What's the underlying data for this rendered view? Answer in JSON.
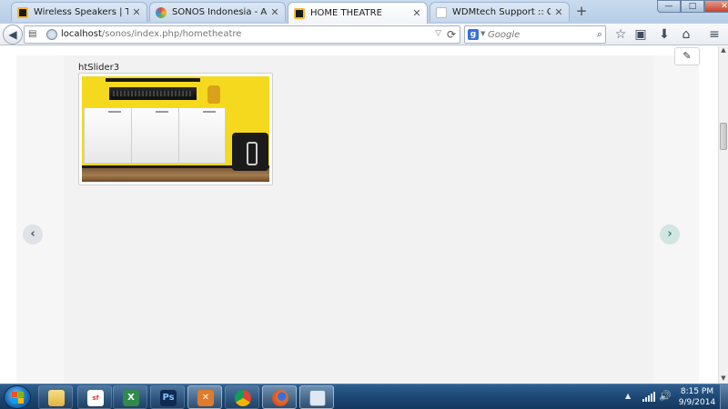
{
  "browser": {
    "tabs": [
      {
        "title": "Wireless Speakers | The Wi...",
        "close": "✕",
        "favicon_color": "#1a1a1a",
        "active": false
      },
      {
        "title": "SONOS Indonesia - Admini...",
        "close": "✕",
        "favicon_color": "#e06a2a",
        "active": false
      },
      {
        "title": "HOME THEATRE",
        "close": "✕",
        "favicon_color": "#1a1a1a",
        "active": true
      },
      {
        "title": "WDMtech Support :: Category L...",
        "close": "✕",
        "favicon_color": "#ffffff",
        "active": false
      }
    ],
    "new_tab_symbol": "+",
    "window_controls": {
      "minimize": "—",
      "maximize": "□",
      "close": "✕"
    },
    "address": {
      "host": "localhost",
      "path": "/sonos/index.php/hometheatre",
      "dropdown_symbol": "▽",
      "reload_symbol": "⟳"
    },
    "search": {
      "engine_icon": "g",
      "placeholder": "Google",
      "search_symbol": "⌕"
    },
    "toolbar_icons": [
      "star-icon",
      "clipboard-icon",
      "download-icon",
      "home-icon",
      "menu-icon"
    ],
    "toolbar_symbols": {
      "star": "☆",
      "reading_list": "▣",
      "downloads": "⬇",
      "home": "⌂",
      "menu": "≡"
    }
  },
  "page": {
    "edit_symbol": "✎",
    "slider_label": "htSlider3",
    "prev_symbol": "‹",
    "next_symbol": "›"
  },
  "taskbar": {
    "apps": [
      {
        "name": "explorer",
        "icon_color": "#e9c46a",
        "label": ""
      },
      {
        "name": "smartfren",
        "icon_color": "#d63a3a",
        "label": ""
      },
      {
        "name": "excel",
        "icon_color": "#2f8a4b",
        "label": ""
      },
      {
        "name": "photoshop",
        "icon_color": "#1e3a6e",
        "label": "Ps"
      },
      {
        "name": "xampp",
        "icon_color": "#e07a2c",
        "label": ""
      },
      {
        "name": "chrome",
        "icon_color": "#4a90d9",
        "label": ""
      },
      {
        "name": "firefox",
        "icon_color": "#e8702a",
        "label": ""
      },
      {
        "name": "window-app",
        "icon_color": "#6b8fb5",
        "label": ""
      }
    ],
    "tray_expand_symbol": "▲",
    "volume_symbol": "🔊",
    "time": "8:15 PM",
    "date": "9/9/2014"
  }
}
